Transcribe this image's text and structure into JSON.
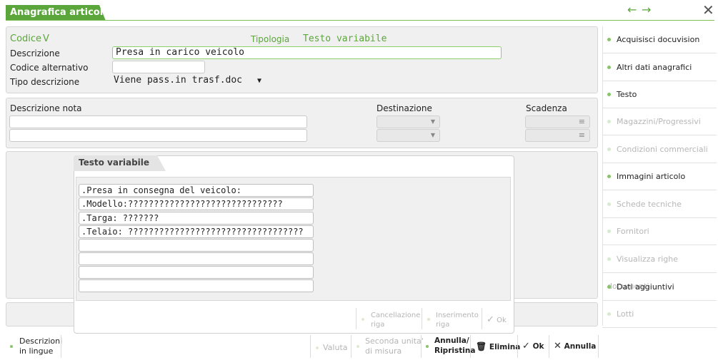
{
  "window": {
    "title": "Anagrafica articoli",
    "accent": "#5aa63a"
  },
  "nav": {
    "back": "←",
    "forward": "→",
    "close": "✕"
  },
  "header": {
    "codice_label": "Codice",
    "codice_value": "V",
    "tipologia_label": "Tipologia",
    "tipologia_value": "Testo variabile",
    "descrizione_label": "Descrizione",
    "descrizione_value": "Presa in carico veicolo",
    "codice_alt_label": "Codice alternativo",
    "codice_alt_value": "",
    "tipo_descr_label": "Tipo descrizione",
    "tipo_descr_value": "Viene pass.in trasf.doc"
  },
  "notes": {
    "descrizione_nota_label": "Descrizione nota",
    "destinazione_label": "Destinazione",
    "scadenza_label": "Scadenza"
  },
  "modal": {
    "title": "Testo variabile",
    "rows": [
      ".Presa in consegna del veicolo:",
      ".Modello:??????????????????????????????",
      ".Targa:  ???????",
      ".Telaio: ??????????????????????????????????",
      "",
      "",
      "",
      ""
    ],
    "buttons": {
      "cancellazione": "Cancellazione riga",
      "inserimento": "Inserimento riga",
      "ok": "Ok"
    }
  },
  "menu": {
    "items": [
      {
        "label": "Acquisisci docuvision",
        "enabled": true
      },
      {
        "label": "Altri dati anagrafici",
        "enabled": true
      },
      {
        "label": "Testo",
        "enabled": true
      },
      {
        "label": "Magazzini/Progressivi",
        "enabled": false
      },
      {
        "label": "Condizioni commerciali",
        "enabled": false
      },
      {
        "label": "Immagini articolo",
        "enabled": true
      },
      {
        "label": "Schede tecniche",
        "enabled": false
      },
      {
        "label": "Fornitori",
        "enabled": false
      },
      {
        "label": "Visualizza righe documenti",
        "enabled": false
      },
      {
        "label": "Dati aggiuntivi",
        "enabled": true
      },
      {
        "label": "Lotti",
        "enabled": false
      }
    ]
  },
  "toolbar": {
    "descrizioni_lingue_1": "Descrizioni",
    "descrizioni_lingue_2": "in lingue",
    "valuta": "Valuta",
    "seconda_um_1": "Seconda unita'",
    "seconda_um_2": "di misura",
    "annulla_ripristina_1": "Annulla/",
    "annulla_ripristina_2": "Ripristina",
    "elimina": "Elimina",
    "ok": "Ok",
    "annulla": "Annulla"
  }
}
